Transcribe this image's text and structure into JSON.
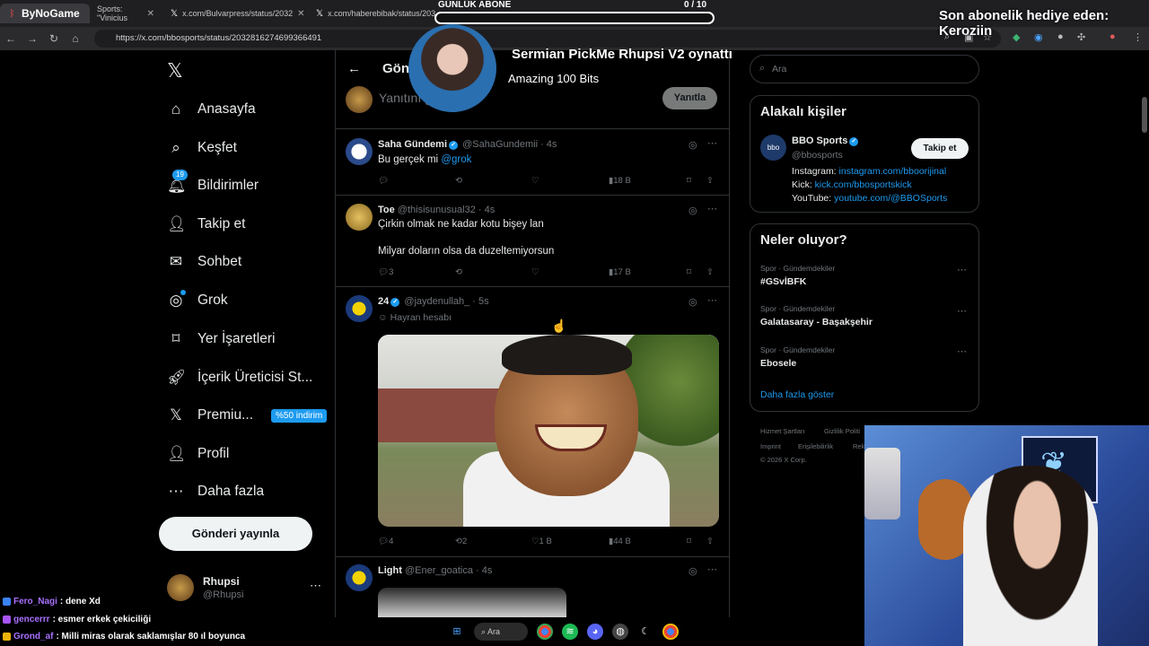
{
  "browser": {
    "tabs": [
      {
        "label": "ByNoGame",
        "favicon": "bynogame-icon"
      },
      {
        "label": "Sports: \"Vinicius",
        "favicon": "x-logo-icon"
      },
      {
        "label": "x.com/Bulvarpress/status/2032",
        "favicon": "x-logo-icon"
      },
      {
        "label": "x.com/haberebibak/status/203",
        "favicon": "x-logo-icon"
      }
    ],
    "url": "https://x.com/bbosports/status/2032816274699366491"
  },
  "overlay": {
    "sub_goal_label": "GÜNLÜK ABONE",
    "sub_goal_count": "0  / 10",
    "sub_goal_progress": 0,
    "gift_text": "Son abonelik hediye eden: Keroziin",
    "alert_title": "Sermian PickMe Rhupsi V2 oynattı",
    "alert_sub": "Amazing 100 Bits"
  },
  "sidebar": {
    "items": [
      {
        "label": "Anasayfa",
        "icon": "home-icon"
      },
      {
        "label": "Keşfet",
        "icon": "search-icon"
      },
      {
        "label": "Bildirimler",
        "icon": "bell-icon",
        "badge": "19"
      },
      {
        "label": "Takip et",
        "icon": "add-user-icon"
      },
      {
        "label": "Sohbet",
        "icon": "mail-icon"
      },
      {
        "label": "Grok",
        "icon": "grok-icon"
      },
      {
        "label": "Yer İşaretleri",
        "icon": "bookmark-icon"
      },
      {
        "label": "İçerik Üreticisi St...",
        "icon": "rocket-icon"
      },
      {
        "label": "Premiu...",
        "icon": "x-logo-icon",
        "pill": "%50 indirim"
      },
      {
        "label": "Profil",
        "icon": "person-icon"
      },
      {
        "label": "Daha fazla",
        "icon": "more-circle-icon"
      }
    ],
    "post_button": "Gönderi yayınla",
    "account": {
      "name": "Rhupsi",
      "handle": "@Rhupsi"
    }
  },
  "main": {
    "header_title": "Gönderi",
    "reply_placeholder": "Yanıtını gönder",
    "reply_button": "Yanıtla",
    "tweets": [
      {
        "name": "Saha Gündemi",
        "handle": "@SahaGundemii · 4s",
        "verified": true,
        "text_prefix": "Bu gerçek mi ",
        "text_link": "@grok",
        "replies": "",
        "retweets": "",
        "likes": "",
        "views": "18 B"
      },
      {
        "name": "Toe",
        "handle": "@thisisunusual32 · 4s",
        "verified": false,
        "line1": "Çirkin olmak ne kadar kotu bişey lan",
        "line2": "Milyar doların olsa da duzeltemiyorsun",
        "replies": "3",
        "retweets": "",
        "likes": "",
        "views": "17 B"
      },
      {
        "name": "24",
        "handle": "@jaydenullah_ · 5s",
        "verified": true,
        "fan_label": "Hayran hesabı",
        "replies": "4",
        "retweets": "2",
        "likes": "1 B",
        "views": "44 B"
      },
      {
        "name": "Light",
        "handle": "@Ener_goatica · 4s",
        "verified": false
      }
    ]
  },
  "right": {
    "search_placeholder": "Ara",
    "relevant_title": "Alakalı kişiler",
    "person": {
      "name": "BBO Sports",
      "handle": "@bbosports",
      "follow": "Takip et",
      "bio": [
        {
          "label": "Instagram: ",
          "link": "instagram.com/bboorijinal"
        },
        {
          "label": "Kick: ",
          "link": "kick.com/bbosportskick"
        },
        {
          "label": "YouTube: ",
          "link": "youtube.com/@BBOSports"
        }
      ]
    },
    "trends_title": "Neler oluyor?",
    "trends": [
      {
        "category": "Spor · Gündemdekiler",
        "name": "#GSvİBFK"
      },
      {
        "category": "Spor · Gündemdekiler",
        "name": "Galatasaray - Başakşehir"
      },
      {
        "category": "Spor · Gündemdekiler",
        "name": "Ebosele"
      }
    ],
    "show_more": "Daha fazla göster",
    "footer": [
      "Hizmet Şartları",
      "Gizlilik Politi",
      "Imprint",
      "Erişilebilirlik",
      "Rek",
      "© 2026 X Corp."
    ]
  },
  "chat": [
    {
      "user": "Fero_Nagi",
      "message": ": dene Xd",
      "badge_color": "#3b82f6"
    },
    {
      "user": "gencerrr",
      "message": ": esmer erkek çekiciliği",
      "badge_color": "#a855f7"
    },
    {
      "user": "Grond_af",
      "message": ": Milli miras olarak saklamışlar 80 ıl boyunca",
      "badge_color": "#eab308"
    }
  ],
  "taskbar": {
    "search_label": "Ara"
  }
}
